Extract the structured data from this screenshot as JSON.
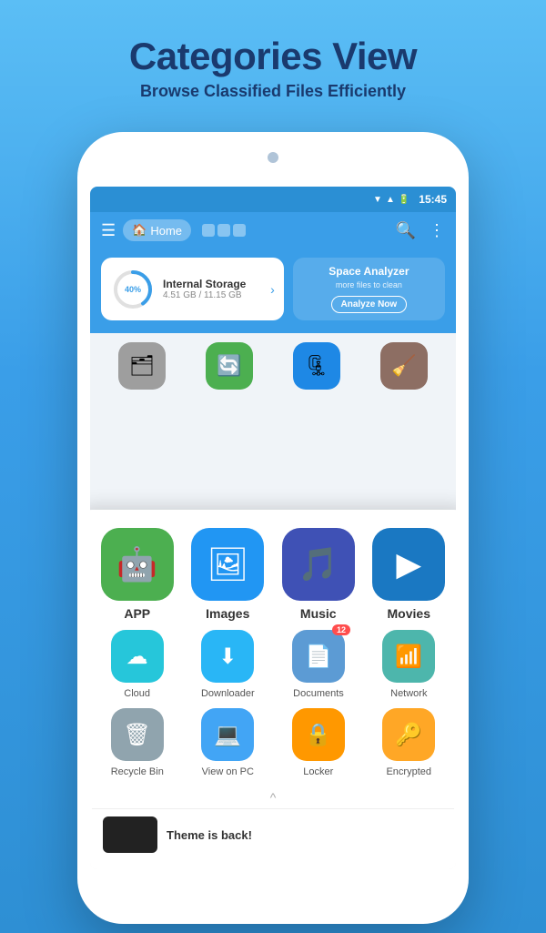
{
  "header": {
    "title": "Categories View",
    "subtitle": "Browse Classified Files Efficiently"
  },
  "status_bar": {
    "time": "15:45"
  },
  "top_bar": {
    "home_label": "Home"
  },
  "storage": {
    "percent": "40%",
    "name": "Internal Storage",
    "used": "4.51 GB / 11.15 GB",
    "analyzer_title": "Space Analyzer",
    "analyzer_sub": "more files to clean",
    "analyze_btn": "Analyze Now"
  },
  "top_categories": [
    {
      "label": "",
      "color": "bg-gray",
      "icon": "🗂"
    },
    {
      "label": "",
      "color": "bg-green-refresh",
      "icon": "🔄"
    },
    {
      "label": "",
      "color": "bg-blue-zip",
      "icon": "🗜"
    },
    {
      "label": "",
      "color": "bg-brown",
      "icon": "🧹"
    }
  ],
  "main_categories_row1": [
    {
      "label": "APP",
      "color": "bg-app",
      "icon": "🤖"
    },
    {
      "label": "Images",
      "color": "bg-images",
      "icon": "🖼"
    },
    {
      "label": "Music",
      "color": "bg-music",
      "icon": "🎵"
    },
    {
      "label": "Movies",
      "color": "bg-movies",
      "icon": "▶"
    }
  ],
  "main_categories_row2": [
    {
      "label": "Cloud",
      "color": "bg-cloud",
      "icon": "☁"
    },
    {
      "label": "Downloader",
      "color": "bg-downloader",
      "icon": "⬇"
    },
    {
      "label": "Documents",
      "color": "bg-documents",
      "icon": "📄",
      "badge": "12"
    },
    {
      "label": "Network",
      "color": "bg-network",
      "icon": "📶"
    }
  ],
  "main_categories_row3": [
    {
      "label": "Recycle Bin",
      "color": "bg-recycle",
      "icon": "🗑"
    },
    {
      "label": "View on PC",
      "color": "bg-viewonpc",
      "icon": "💻"
    },
    {
      "label": "Locker",
      "color": "bg-locker",
      "icon": "🔒"
    },
    {
      "label": "Encrypted",
      "color": "bg-encrypted",
      "icon": "🔑"
    }
  ],
  "theme_banner": {
    "text": "Theme is back!"
  }
}
